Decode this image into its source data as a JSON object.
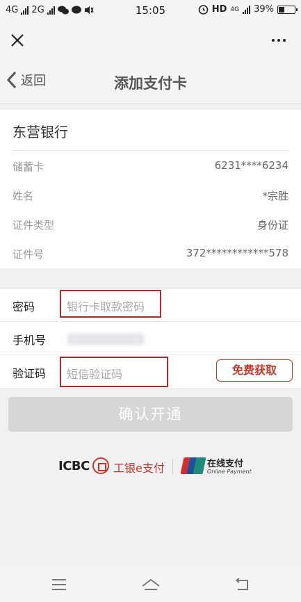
{
  "status_bar": {
    "left_text_1": "4G",
    "left_text_2": "2G",
    "time": "15:05",
    "hd": "HD",
    "net": "4G",
    "battery": "39%",
    "battery_level": 0.39
  },
  "nav": {
    "back_label": "返回",
    "title": "添加支付卡"
  },
  "card_info": {
    "bank_name": "东营银行",
    "rows": [
      {
        "label": "储蓄卡",
        "value": "6231****6234"
      },
      {
        "label": "姓名",
        "value": "*宗胜"
      },
      {
        "label": "证件类型",
        "value": "身份证"
      },
      {
        "label": "证件号",
        "value": "372************578"
      }
    ]
  },
  "form": {
    "password_label": "密码",
    "password_placeholder": "银行卡取款密码",
    "phone_label": "手机号",
    "code_label": "验证码",
    "code_placeholder": "短信验证码",
    "sms_button": "免费获取"
  },
  "confirm_label": "确认开通",
  "logos": {
    "icbc": "ICBC",
    "icbc_pay": "工银e支付",
    "unionpay": "在线支付",
    "unionpay_sub": "Online Payment"
  },
  "colors": {
    "accent": "#c0392b",
    "disabled_button": "#d6d6d9"
  }
}
